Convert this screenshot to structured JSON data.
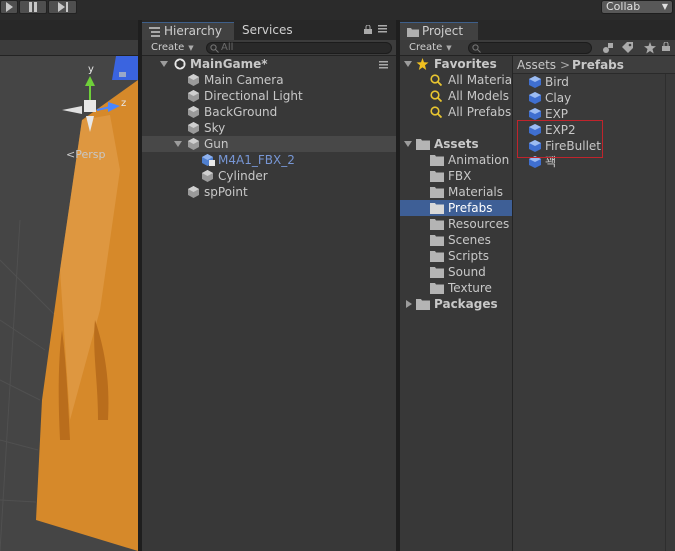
{
  "toolbar": {
    "collab_label": "Collab"
  },
  "scene": {
    "persp_label": "Persp",
    "gizmo": {
      "y": "y",
      "z": "z"
    }
  },
  "hierarchy": {
    "tab_label": "Hierarchy",
    "services_tab": "Services",
    "create_label": "Create",
    "search_placeholder": "All",
    "scene_name": "MainGame*",
    "items": [
      {
        "label": "Main Camera"
      },
      {
        "label": "Directional Light"
      },
      {
        "label": "BackGround"
      },
      {
        "label": "Sky"
      },
      {
        "label": "Gun"
      },
      {
        "label": "M4A1_FBX_2"
      },
      {
        "label": "Cylinder"
      },
      {
        "label": "spPoint"
      }
    ]
  },
  "project": {
    "tab_label": "Project",
    "create_label": "Create",
    "favorites": {
      "label": "Favorites",
      "items": [
        "All Material",
        "All Models",
        "All Prefabs"
      ]
    },
    "assets": {
      "label": "Assets",
      "folders": [
        "Animation",
        "FBX",
        "Materials",
        "Prefabs",
        "Resources",
        "Scenes",
        "Scripts",
        "Sound",
        "Texture"
      ],
      "selected": "Prefabs"
    },
    "packages_label": "Packages",
    "breadcrumb": {
      "root": "Assets",
      "separator": ">",
      "current": "Prefabs"
    },
    "prefabs": [
      "Bird",
      "Clay",
      "EXP",
      "EXP2",
      "FireBullet",
      "꽥"
    ],
    "highlight_color": "#c0242c"
  },
  "colors": {
    "selection": "#3e5f96",
    "panel_bg": "#383838",
    "scene_object": "#d6892a",
    "scene_sky": "#3a64e0"
  }
}
